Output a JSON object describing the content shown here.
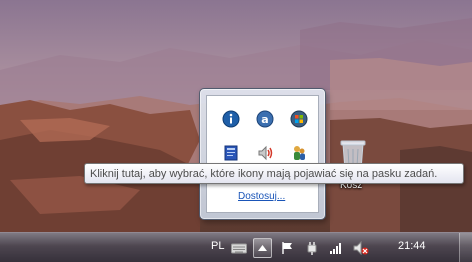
{
  "tray_popup": {
    "icons": [
      {
        "name": "info-icon"
      },
      {
        "name": "avast-icon"
      },
      {
        "name": "windows-update-icon"
      },
      {
        "name": "dictionary-icon"
      },
      {
        "name": "volume-icon"
      },
      {
        "name": "users-icon"
      }
    ],
    "customize_label": "Dostosuj..."
  },
  "tooltip": {
    "text": "Kliknij tutaj, aby wybrać, które ikony mają pojawiać się na pasku zadań."
  },
  "desktop": {
    "recycle_bin_label": "Kosz"
  },
  "taskbar": {
    "language": "PL",
    "clock": "21:44",
    "icons": [
      "keyboard-icon",
      "show-hidden-icons-chevron",
      "action-center-flag-icon",
      "power-plug-icon",
      "network-signal-icon",
      "volume-muted-icon"
    ]
  },
  "colors": {
    "link": "#1a55b8",
    "tooltip_text": "#4c4c4c"
  }
}
